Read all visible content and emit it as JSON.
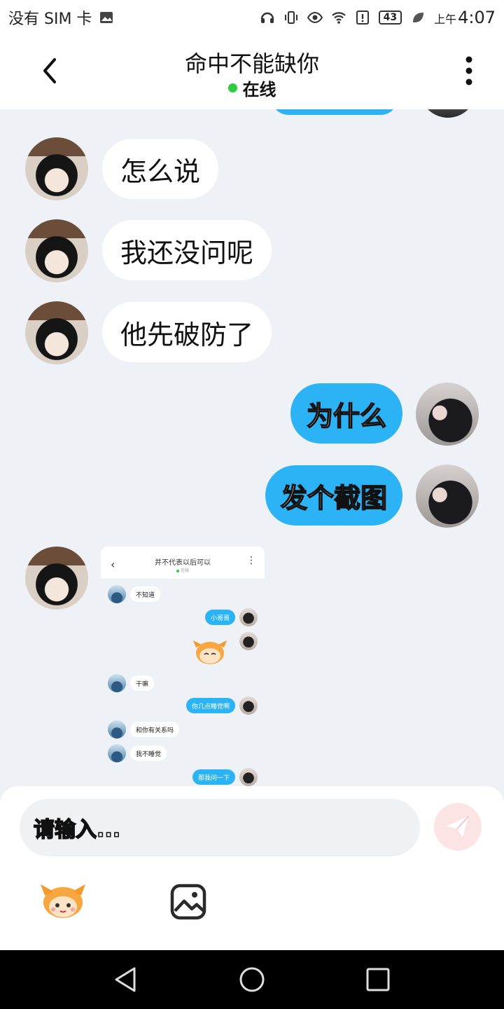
{
  "status_bar": {
    "carrier": "没有 SIM 卡",
    "battery": "43",
    "ampm": "上午",
    "time": "4:07"
  },
  "header": {
    "title": "命中不能缺你",
    "status": "在线"
  },
  "messages": [
    {
      "from": "other",
      "text": "怎么说"
    },
    {
      "from": "other",
      "text": "我还没问呢"
    },
    {
      "from": "other",
      "text": "他先破防了"
    },
    {
      "from": "me",
      "text": "为什么"
    },
    {
      "from": "me",
      "text": "发个截图"
    }
  ],
  "shared_screenshot": {
    "title": "并不代表以后可以",
    "status": "在线",
    "messages": [
      {
        "from": "other",
        "text": "不知道"
      },
      {
        "from": "me",
        "text": "小哥哥"
      },
      {
        "from": "other",
        "text": "干嘛"
      },
      {
        "from": "me",
        "text": "你几点睡觉啊"
      },
      {
        "from": "other",
        "text": "和你有关系吗"
      },
      {
        "from": "other",
        "text": "我不睡觉"
      },
      {
        "from": "me",
        "text": "那我问一下"
      }
    ]
  },
  "input": {
    "placeholder": "请输入..."
  },
  "colors": {
    "accent": "#2bb3f5",
    "online": "#2ecc40",
    "send_bg": "#fde4e4"
  }
}
